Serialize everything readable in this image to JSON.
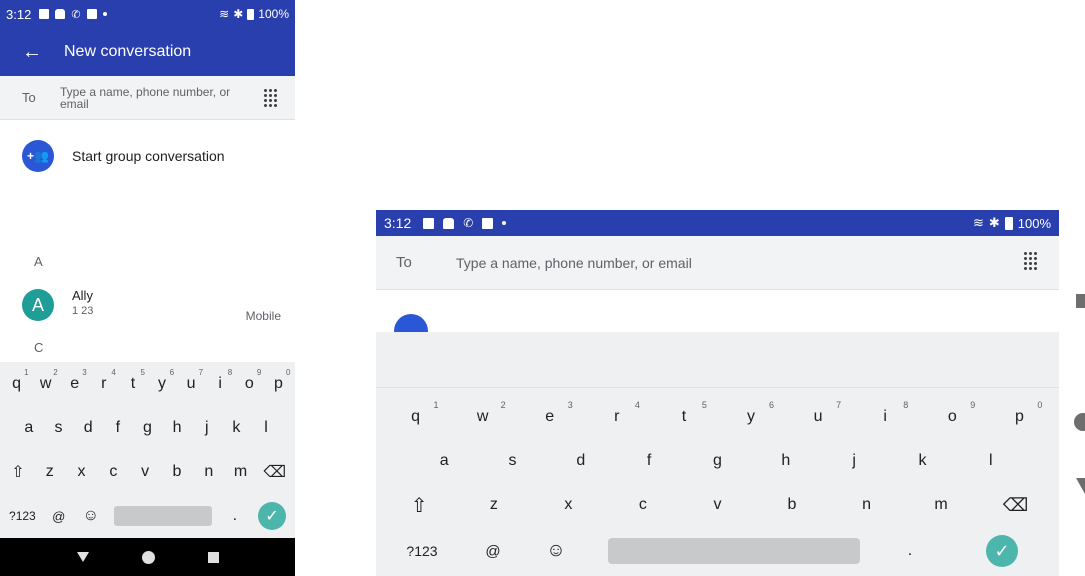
{
  "phoneA": {
    "status": {
      "time": "3:12",
      "battery": "100%"
    },
    "appbar": {
      "back_icon": "←",
      "title": "New conversation"
    },
    "to_label": "To",
    "to_placeholder": "Type a name, phone number, or email",
    "group": {
      "icon": "+👥",
      "label": "Start group conversation"
    },
    "sections": [
      "A",
      "C"
    ],
    "contact": {
      "avatar_letter": "A",
      "name": "Ally",
      "number": "1 23",
      "type": "Mobile"
    }
  },
  "phoneB": {
    "status": {
      "time": "3:12",
      "battery": "100%"
    },
    "to_label": "To",
    "to_placeholder": "Type a name, phone number, or email"
  },
  "keyboard": {
    "row1": [
      {
        "k": "q",
        "n": "1"
      },
      {
        "k": "w",
        "n": "2"
      },
      {
        "k": "e",
        "n": "3"
      },
      {
        "k": "r",
        "n": "4"
      },
      {
        "k": "t",
        "n": "5"
      },
      {
        "k": "y",
        "n": "6"
      },
      {
        "k": "u",
        "n": "7"
      },
      {
        "k": "i",
        "n": "8"
      },
      {
        "k": "o",
        "n": "9"
      },
      {
        "k": "p",
        "n": "0"
      }
    ],
    "row2": [
      "a",
      "s",
      "d",
      "f",
      "g",
      "h",
      "j",
      "k",
      "l"
    ],
    "row3": [
      "z",
      "x",
      "c",
      "v",
      "b",
      "n",
      "m"
    ],
    "shift_icon": "⇧",
    "backspace_icon": "⌫",
    "sym_label": "?123",
    "at_label": "@",
    "emoji_icon": "☺",
    "period_label": ".",
    "check_icon": "✓"
  }
}
